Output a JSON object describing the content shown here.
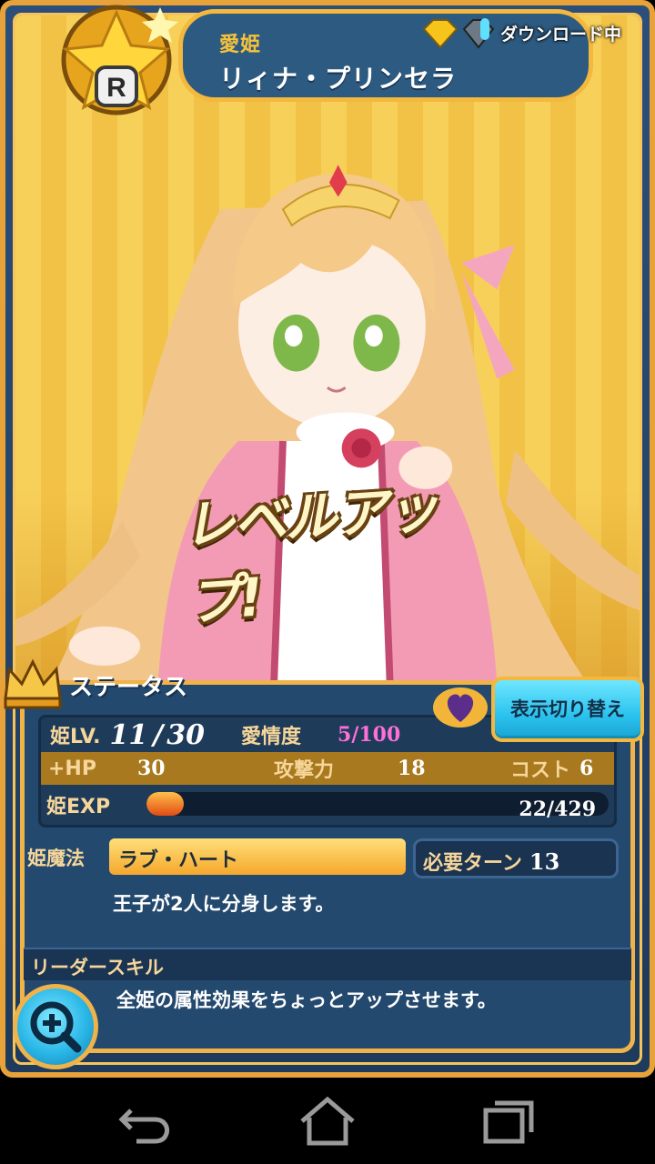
{
  "header": {
    "rarity": "R",
    "title": "愛姫",
    "name": "リィナ・プリンセラ",
    "download_status": "ダウンロード中"
  },
  "banner": {
    "text": "レベルアップ!"
  },
  "status": {
    "title": "ステータス",
    "toggle_button": "表示切り替え",
    "level_label": "姫LV.",
    "level_current": "11",
    "level_sep": "/",
    "level_max": "30",
    "affection_label": "愛情度",
    "affection_value": "5/100",
    "hp_label": "+HP",
    "hp_value": "30",
    "attack_label": "攻撃力",
    "attack_value": "18",
    "cost_label": "コスト",
    "cost_value": "6",
    "exp_label": "姫EXP",
    "exp_value": "22/429",
    "exp_fraction": 0.051
  },
  "skill": {
    "label": "姫魔法",
    "name": "ラブ・ハート",
    "turn_label": "必要ターン",
    "turn_value": "13",
    "description": "王子が2人に分身します。"
  },
  "leader": {
    "label": "リーダースキル",
    "description": "全姫の属性効果をちょっとアップさせます。"
  },
  "icons": {
    "zoom": "zoom-in-icon",
    "crown": "crown-icon",
    "back": "back-icon",
    "home": "home-icon",
    "recents": "recents-icon"
  }
}
